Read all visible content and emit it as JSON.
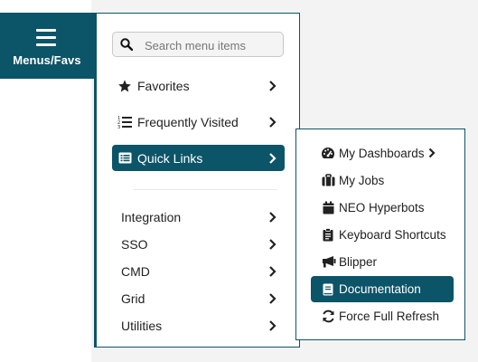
{
  "colors": {
    "accent": "#0c5468",
    "text": "#222222",
    "background": "#f3f3f3"
  },
  "menu_button": {
    "label": "Menus/Favs",
    "icon": "hamburger-icon"
  },
  "search": {
    "placeholder": "Search menu items",
    "value": "",
    "icon": "search-icon"
  },
  "main_menu": {
    "primary_items": [
      {
        "label": "Favorites",
        "icon": "star-icon"
      },
      {
        "label": "Frequently Visited",
        "icon": "ordered-list-icon"
      },
      {
        "label": "Quick Links",
        "icon": "list-box-icon",
        "active": true
      }
    ],
    "plain_items": [
      {
        "label": "Integration"
      },
      {
        "label": "SSO"
      },
      {
        "label": "CMD"
      },
      {
        "label": "Grid"
      },
      {
        "label": "Utilities"
      }
    ]
  },
  "quick_links": {
    "items": [
      {
        "label": "My Dashboards",
        "icon": "dashboard-icon",
        "has_submenu": true
      },
      {
        "label": "My Jobs",
        "icon": "briefcase-icon"
      },
      {
        "label": "NEO Hyperbots",
        "icon": "calendar-icon"
      },
      {
        "label": "Keyboard Shortcuts",
        "icon": "clipboard-icon"
      },
      {
        "label": "Blipper",
        "icon": "megaphone-icon"
      },
      {
        "label": "Documentation",
        "icon": "book-icon",
        "active": true
      },
      {
        "label": "Force Full Refresh",
        "icon": "refresh-icon"
      }
    ]
  }
}
